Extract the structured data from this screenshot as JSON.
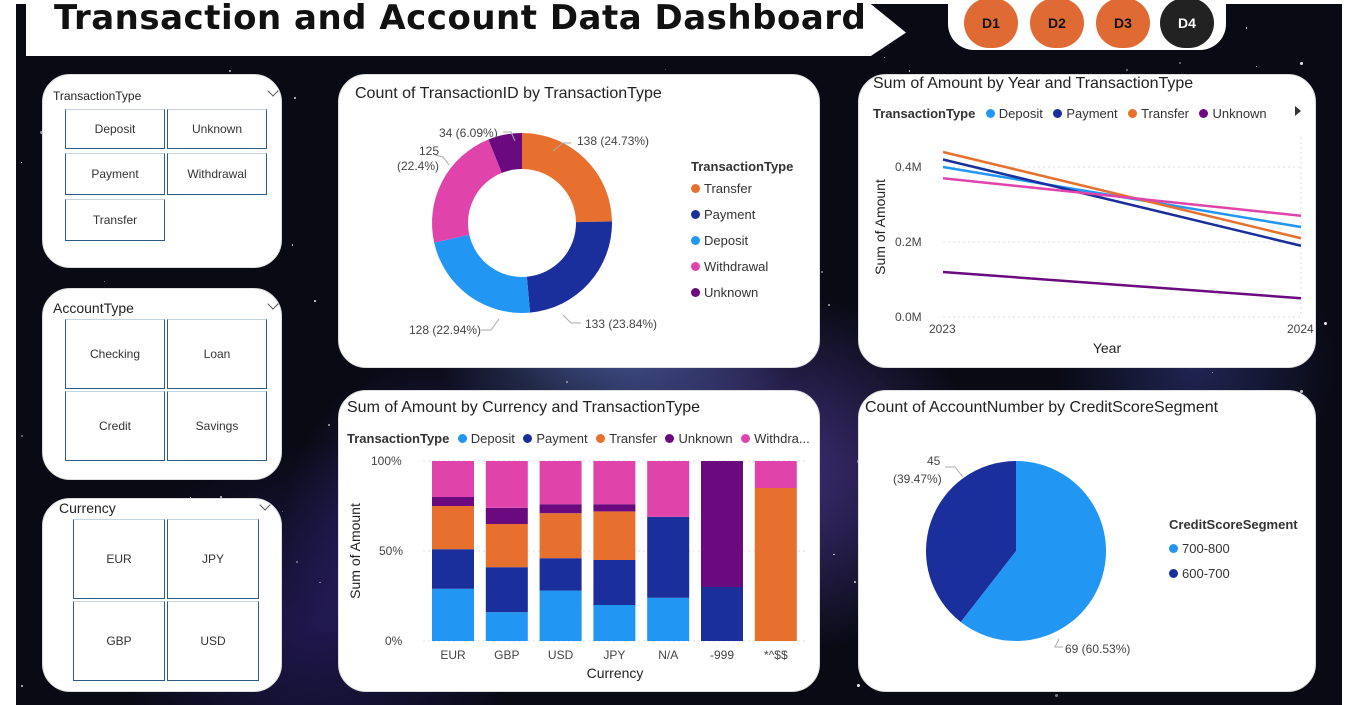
{
  "title": "Transaction and Account Data Dashboard",
  "nav": [
    {
      "label": "D1",
      "color": "#e06a34"
    },
    {
      "label": "D2",
      "color": "#e06a34"
    },
    {
      "label": "D3",
      "color": "#e06a34"
    },
    {
      "label": "D4",
      "color": "#222222"
    }
  ],
  "colors": {
    "deposit": "#2196f3",
    "payment": "#1a2e9c",
    "transfer": "#e8702f",
    "unknown": "#6a0a7e",
    "withdrawal": "#e044ab",
    "seg700": "#2196f3",
    "seg600": "#1a2e9c"
  },
  "slicers": {
    "transaction_type": {
      "title": "TransactionType",
      "items": [
        "Deposit",
        "Unknown",
        "Payment",
        "Withdrawal",
        "Transfer"
      ]
    },
    "account_type": {
      "title": "AccountType",
      "items": [
        "Checking",
        "Loan",
        "Credit",
        "Savings"
      ]
    },
    "currency": {
      "title": "Currency",
      "items": [
        "EUR",
        "JPY",
        "GBP",
        "USD"
      ]
    }
  },
  "charts": {
    "donut": {
      "title": "Count of TransactionID by TransactionType",
      "legend_title": "TransactionType",
      "legend": [
        "Transfer",
        "Payment",
        "Deposit",
        "Withdrawal",
        "Unknown"
      ],
      "labels": {
        "transfer": "138 (24.73%)",
        "payment": "133 (23.84%)",
        "deposit": "128 (22.94%)",
        "withdrawal_line1": "125",
        "withdrawal_line2": "(22.4%)",
        "unknown": "34 (6.09%)"
      }
    },
    "line": {
      "title": "Sum of Amount by Year and TransactionType",
      "legend_title": "TransactionType",
      "legend": [
        "Deposit",
        "Payment",
        "Transfer",
        "Unknown"
      ],
      "ylabel": "Sum of Amount",
      "xlabel": "Year",
      "yticks": [
        "0.4M",
        "0.2M",
        "0.0M"
      ],
      "xticks": [
        "2023",
        "2024"
      ]
    },
    "stacked": {
      "title": "Sum of Amount by Currency and TransactionType",
      "legend_title": "TransactionType",
      "legend": [
        "Deposit",
        "Payment",
        "Transfer",
        "Unknown",
        "Withdra..."
      ],
      "ylabel": "Sum of Amount",
      "xlabel": "Currency",
      "yticks": [
        "100%",
        "50%",
        "0%"
      ]
    },
    "pie": {
      "title": "Count of AccountNumber by CreditScoreSegment",
      "legend_title": "CreditScoreSegment",
      "legend": [
        "700-800",
        "600-700"
      ],
      "labels": {
        "seg600_line1": "45",
        "seg600_line2": "(39.47%)",
        "seg700": "69 (60.53%)"
      }
    }
  },
  "chart_data": [
    {
      "type": "pie",
      "title": "Count of TransactionID by TransactionType",
      "categories": [
        "Transfer",
        "Payment",
        "Deposit",
        "Withdrawal",
        "Unknown"
      ],
      "values": [
        138,
        133,
        128,
        125,
        34
      ],
      "percent": [
        24.73,
        23.84,
        22.94,
        22.4,
        6.09
      ]
    },
    {
      "type": "line",
      "title": "Sum of Amount by Year and TransactionType",
      "x": [
        2023,
        2024
      ],
      "series": [
        {
          "name": "Deposit",
          "values": [
            400000,
            240000
          ]
        },
        {
          "name": "Payment",
          "values": [
            420000,
            190000
          ]
        },
        {
          "name": "Transfer",
          "values": [
            440000,
            210000
          ]
        },
        {
          "name": "Unknown",
          "values": [
            120000,
            50000
          ]
        },
        {
          "name": "Withdrawal",
          "values": [
            370000,
            270000
          ]
        }
      ],
      "ylim": [
        0,
        480000
      ],
      "xlabel": "Year",
      "ylabel": "Sum of Amount"
    },
    {
      "type": "bar",
      "title": "Sum of Amount by Currency and TransactionType",
      "stacked_percent": true,
      "categories": [
        "EUR",
        "GBP",
        "USD",
        "JPY",
        "N/A",
        "-999",
        "*^$$"
      ],
      "series": [
        {
          "name": "Deposit",
          "values": [
            29,
            16,
            28,
            20,
            24,
            0,
            0
          ]
        },
        {
          "name": "Payment",
          "values": [
            22,
            25,
            18,
            25,
            45,
            30,
            0
          ]
        },
        {
          "name": "Transfer",
          "values": [
            24,
            24,
            25,
            27,
            0,
            0,
            85
          ]
        },
        {
          "name": "Unknown",
          "values": [
            5,
            9,
            5,
            4,
            0,
            70,
            0
          ]
        },
        {
          "name": "Withdrawal",
          "values": [
            20,
            26,
            24,
            24,
            31,
            0,
            15
          ]
        }
      ],
      "ylim": [
        0,
        100
      ],
      "xlabel": "Currency",
      "ylabel": "Sum of Amount"
    },
    {
      "type": "pie",
      "title": "Count of AccountNumber by CreditScoreSegment",
      "categories": [
        "700-800",
        "600-700"
      ],
      "values": [
        69,
        45
      ],
      "percent": [
        60.53,
        39.47
      ]
    }
  ]
}
